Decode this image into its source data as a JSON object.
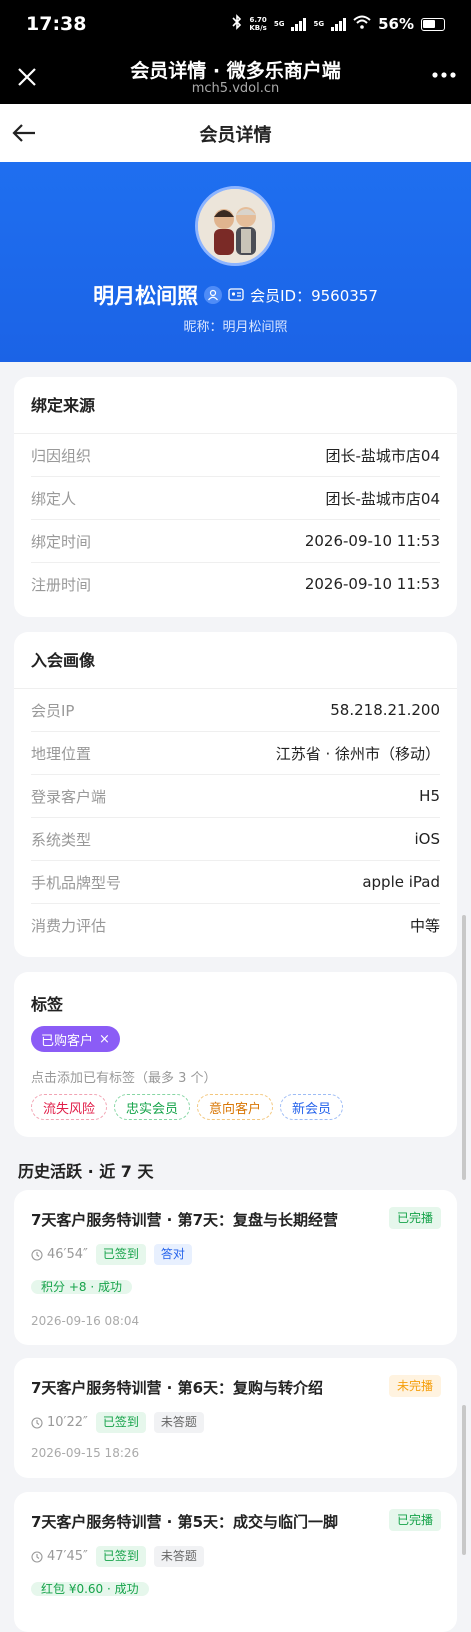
{
  "status_bar": {
    "time": "17:38",
    "speed_top": "6.70",
    "speed_bottom": "KB/s",
    "net1": "5G",
    "net2": "5G",
    "battery": "56%"
  },
  "browser": {
    "title": "会员详情 · 微多乐商户端",
    "domain": "mch5.vdol.cn"
  },
  "nav": {
    "title": "会员详情"
  },
  "profile": {
    "name": "明月松间照",
    "member_id": "会员ID：9560357",
    "nickname": "昵称：明月松间照"
  },
  "binding": {
    "title": "绑定来源",
    "rows": [
      {
        "label": "归因组织",
        "value": "团长-盐城市店04"
      },
      {
        "label": "绑定人",
        "value": "团长-盐城市店04"
      },
      {
        "label": "绑定时间",
        "value": "2026-09-10 11:53"
      },
      {
        "label": "注册时间",
        "value": "2026-09-10 11:53"
      }
    ]
  },
  "portrait": {
    "title": "入会画像",
    "rows": [
      {
        "label": "会员IP",
        "value": "58.218.21.200"
      },
      {
        "label": "地理位置",
        "value": "江苏省 · 徐州市（移动）"
      },
      {
        "label": "登录客户端",
        "value": "H5"
      },
      {
        "label": "系统类型",
        "value": "iOS"
      },
      {
        "label": "手机品牌型号",
        "value": "apple iPad"
      },
      {
        "label": "消费力评估",
        "value": "中等"
      }
    ]
  },
  "tags": {
    "title": "标签",
    "current": "已购客户",
    "remove": "×",
    "hint": "点击添加已有标签（最多 3 个）",
    "options": [
      {
        "label": "流失风险",
        "color": "#e11d48"
      },
      {
        "label": "忠实会员",
        "color": "#16a34a"
      },
      {
        "label": "意向客户",
        "color": "#d97706"
      },
      {
        "label": "新会员",
        "color": "#2563eb"
      }
    ]
  },
  "history": {
    "title": "历史活跃 · 近 7 天",
    "items": [
      {
        "title": "7天客户服务特训营 · 第7天：复盘与长期经营",
        "status": "已完播",
        "duration": "46′54″",
        "checkin": "已签到",
        "answer": "答对",
        "reward": "积分 +8 · 成功",
        "time": "2026-09-16 08:04"
      },
      {
        "title": "7天客户服务特训营 · 第6天：复购与转介绍",
        "status": "未完播",
        "duration": "10′22″",
        "checkin": "已签到",
        "answer": "未答题",
        "reward": "",
        "time": "2026-09-15 18:26"
      },
      {
        "title": "7天客户服务特训营 · 第5天：成交与临门一脚",
        "status": "已完播",
        "duration": "47′45″",
        "checkin": "已签到",
        "answer": "未答题",
        "reward": "红包 ¥0.60 · 成功",
        "time": ""
      }
    ]
  }
}
